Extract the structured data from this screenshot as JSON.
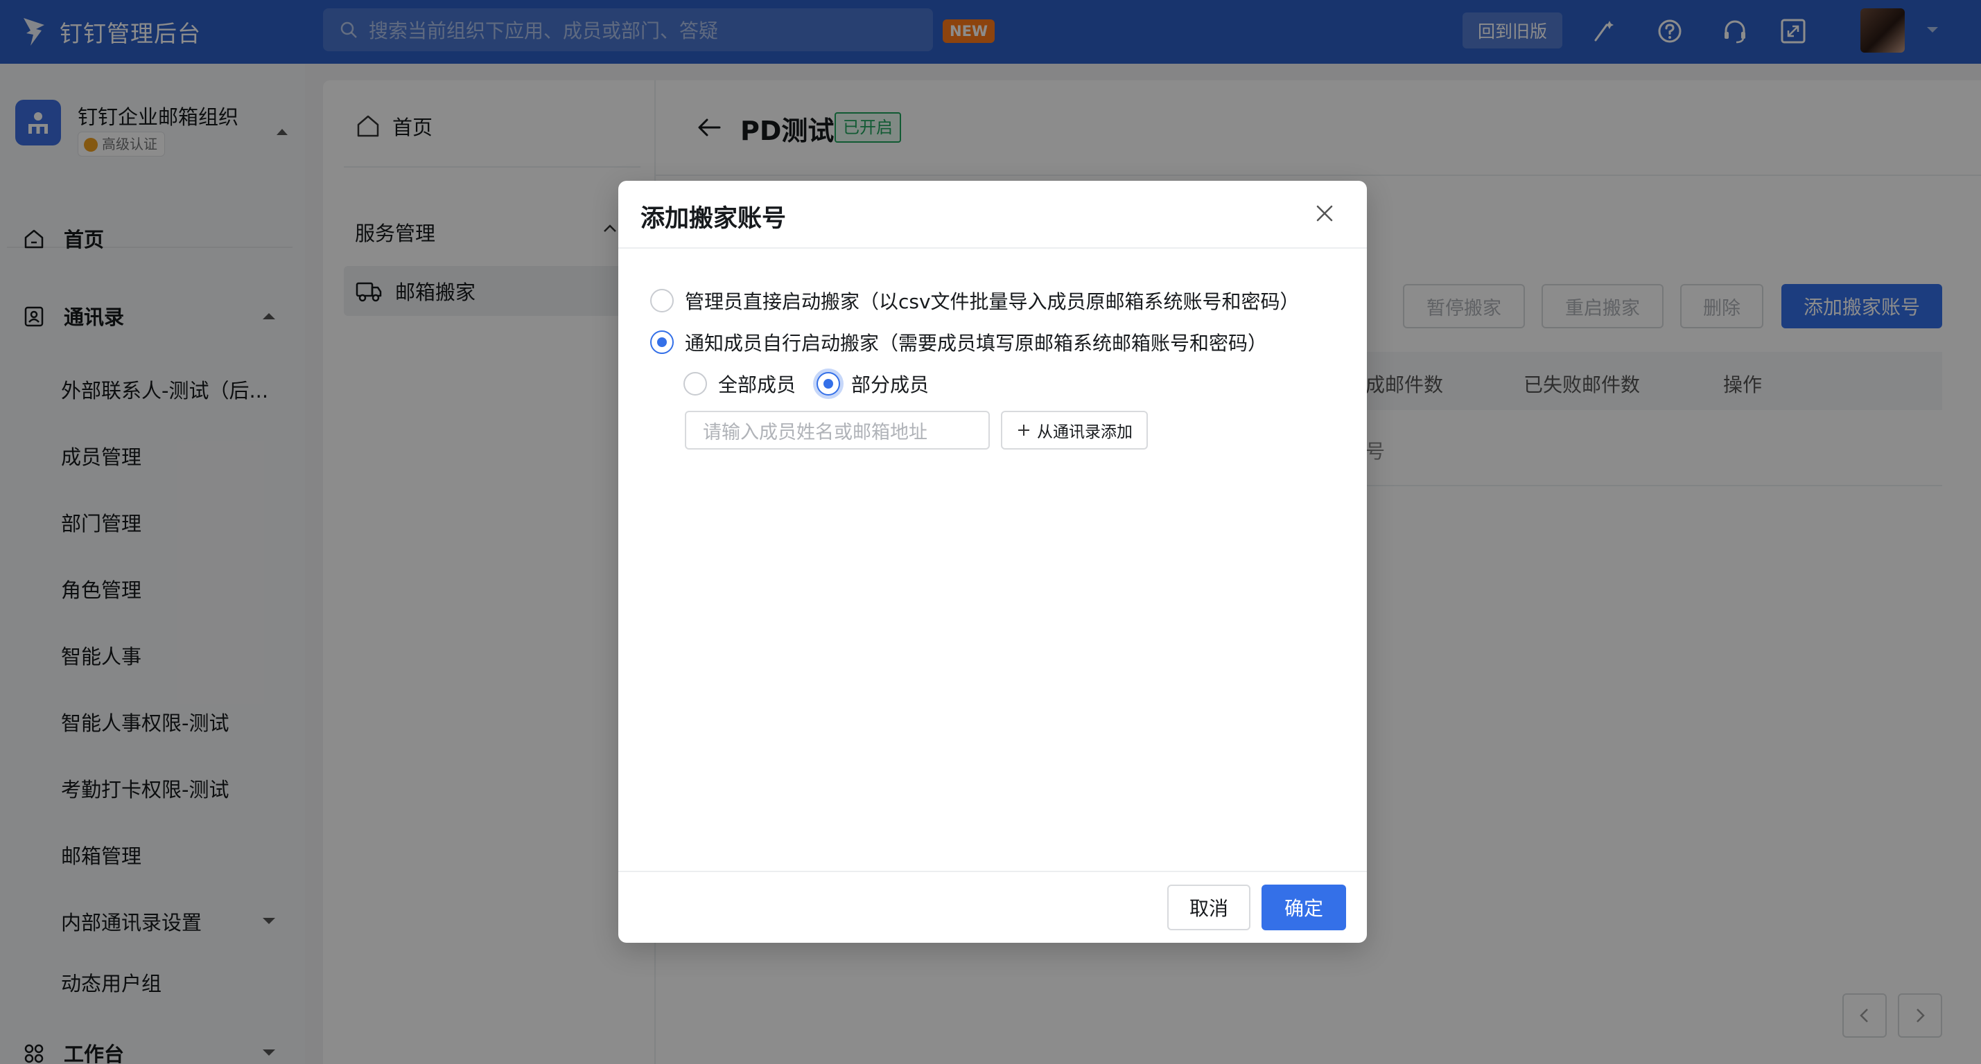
{
  "topbar": {
    "brand": "钉钉管理后台",
    "search_placeholder": "搜索当前组织下应用、成员或部门、答疑",
    "new_badge": "NEW",
    "back_to_old": "回到旧版",
    "icons": [
      "magic-wand-icon",
      "help-icon",
      "customer-service-icon",
      "fullscreen-icon"
    ],
    "colors": {
      "bar": "#2c5fc6",
      "new_badge": "#ff7a1a"
    }
  },
  "org": {
    "name": "钉钉企业邮箱组织",
    "certification": "高级认证"
  },
  "leftnav": {
    "home": "首页",
    "contacts": "通讯录",
    "contacts_items": [
      "外部联系人-测试（后...",
      "成员管理",
      "部门管理",
      "角色管理",
      "智能人事",
      "智能人事权限-测试",
      "考勤打卡权限-测试",
      "邮箱管理",
      "内部通讯录设置",
      "动态用户组"
    ],
    "workbench": "工作台"
  },
  "midnav": {
    "home": "首页",
    "group": "服务管理",
    "active_item": "邮箱搬家"
  },
  "main": {
    "title": "PD测试",
    "status": "已开启",
    "buttons": {
      "pause": "暂停搬家",
      "restart": "重启搬家",
      "delete": "删除",
      "add": "添加搬家账号"
    },
    "table_headers": {
      "completed": "已完成邮件数",
      "failed": "已失败邮件数",
      "actions": "操作"
    },
    "row_fragment": "号"
  },
  "modal": {
    "title": "添加搬家账号",
    "option_admin": "管理员直接启动搬家（以csv文件批量导入成员原邮箱系统账号和密码）",
    "option_notify": "通知成员自行启动搬家（需要成员填写原邮箱系统邮箱账号和密码）",
    "selected_option": "notify",
    "scope_all": "全部成员",
    "scope_partial": "部分成员",
    "selected_scope": "partial",
    "input_placeholder": "请输入成员姓名或邮箱地址",
    "from_contacts": "从通讯录添加",
    "cancel": "取消",
    "confirm": "确定",
    "accent": "#3470e8"
  }
}
